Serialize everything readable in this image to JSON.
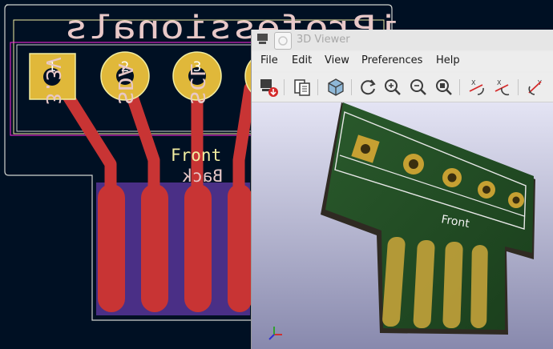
{
  "pcb_editor": {
    "silk_title": "iProfessionals",
    "pins": [
      {
        "number": "1",
        "label": "3.3V"
      },
      {
        "number": "2",
        "label": "SDA"
      },
      {
        "number": "3",
        "label": "SCL"
      }
    ],
    "front_label": "Front",
    "back_label": "Back"
  },
  "viewer": {
    "title": "3D Viewer",
    "menu": [
      "File",
      "Edit",
      "View",
      "Preferences",
      "Help"
    ],
    "toolbar_icons": [
      "export-image-icon",
      "copy-to-clipboard-icon",
      "render-mode-icon",
      "refresh-icon",
      "zoom-in-icon",
      "zoom-out-icon",
      "zoom-fit-icon",
      "rotate-x-clockwise-icon",
      "rotate-x-counterclockwise-icon",
      "rotate-y-icon"
    ],
    "board_label": "Front"
  },
  "colors": {
    "pcb_background": "#001023",
    "edge_cut": "#d0d2cd",
    "pad_gold": "#e0b83a",
    "track_red": "#c83434",
    "courtyard": "#ff26e2",
    "back_silk": "#e8c8c8",
    "front_silk": "#f2eda1",
    "board_green": "#1c4a22"
  }
}
